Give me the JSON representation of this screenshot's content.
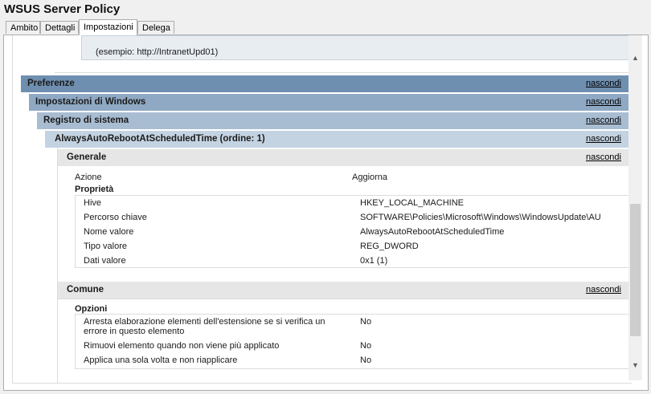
{
  "window": {
    "title": "WSUS Server Policy"
  },
  "tabs": [
    {
      "label": "Ambito"
    },
    {
      "label": "Dettagli"
    },
    {
      "label": "Impostazioni"
    },
    {
      "label": "Delega"
    }
  ],
  "top_example": "(esempio: http://IntranetUpd01)",
  "sections": {
    "preferenze": {
      "label": "Preferenze",
      "link": "nascondi"
    },
    "impostazioni_windows": {
      "label": "Impostazioni di Windows",
      "link": "nascondi"
    },
    "registro": {
      "label": "Registro di sistema",
      "link": "nascondi"
    },
    "item": {
      "label": "AlwaysAutoRebootAtScheduledTime (ordine: 1)",
      "link": "nascondi"
    },
    "generale": {
      "label": "Generale",
      "link": "nascondi"
    },
    "comune": {
      "label": "Comune",
      "link": "nascondi"
    }
  },
  "generale": {
    "azione_label": "Azione",
    "azione_value": "Aggiorna",
    "proprieta_title": "Proprietà",
    "rows": [
      {
        "label": "Hive",
        "value": "HKEY_LOCAL_MACHINE"
      },
      {
        "label": "Percorso chiave",
        "value": "SOFTWARE\\Policies\\Microsoft\\Windows\\WindowsUpdate\\AU"
      },
      {
        "label": "Nome valore",
        "value": "AlwaysAutoRebootAtScheduledTime"
      },
      {
        "label": "Tipo valore",
        "value": "REG_DWORD"
      },
      {
        "label": "Dati valore",
        "value": "0x1 (1)"
      }
    ]
  },
  "comune": {
    "opzioni_title": "Opzioni",
    "rows": [
      {
        "label": "Arresta elaborazione elementi dell'estensione se si verifica un errore in questo elemento",
        "value": "No"
      },
      {
        "label": "Rimuovi elemento quando non viene più applicato",
        "value": "No"
      },
      {
        "label": "Applica una sola volta e non riapplicare",
        "value": "No"
      }
    ]
  },
  "colors": {
    "preferenze": "#6f8fb0",
    "windows": "#8fa9c4",
    "registro": "#a9bdd2",
    "item": "#c4d3e2",
    "subsection": "#e6e6e6"
  }
}
